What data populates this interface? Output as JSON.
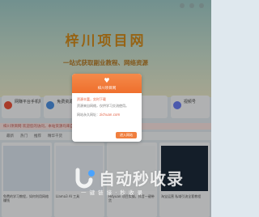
{
  "hero": {
    "title": "梓川项目网",
    "subtitle": "一站式获取副业教程、网络资源"
  },
  "cards": [
    {
      "title": "网赚平台手机赚钱",
      "color": "#e9523b"
    },
    {
      "title": "免费资源教程",
      "color": "#4b8fe0"
    },
    {
      "title": "",
      "color": "#f4a733"
    },
    {
      "title": "",
      "color": "#3db37a"
    },
    {
      "title": "视频号",
      "color": "#6a7df0"
    }
  ],
  "notice": "梓川项目网 欢迎您的访问，本站资源均来自互联网收集，仅供学习交流",
  "tabs": [
    "最新",
    "热门",
    "推荐",
    "精华干货"
  ],
  "tiles": [
    {
      "caption": "免费的学习教程，如何利用网络赚钱",
      "thumb": "#d9e2ec"
    },
    {
      "caption": "Llama3 AI 工具",
      "thumb": "#e8edf4"
    },
    {
      "caption": "Hdyuan 项目实操，抖音一键带货",
      "thumb": "#f2f4f6"
    },
    {
      "caption": "淘宝运营 私域引流全套教程",
      "thumb": "#1d2a3a"
    }
  ],
  "modal": {
    "title": "梓川项目网",
    "line1": "资源丰富，实时下载",
    "line2": "资源来自网络，仅供学习交流使用。",
    "line3_prefix": "网站永久网址：",
    "line3_url": "zichuan.com",
    "enter_label": "进入网站"
  },
  "watermark": {
    "title": "自动秒收录",
    "subtitle": "一 键 链 接 · 秒 收 录"
  }
}
